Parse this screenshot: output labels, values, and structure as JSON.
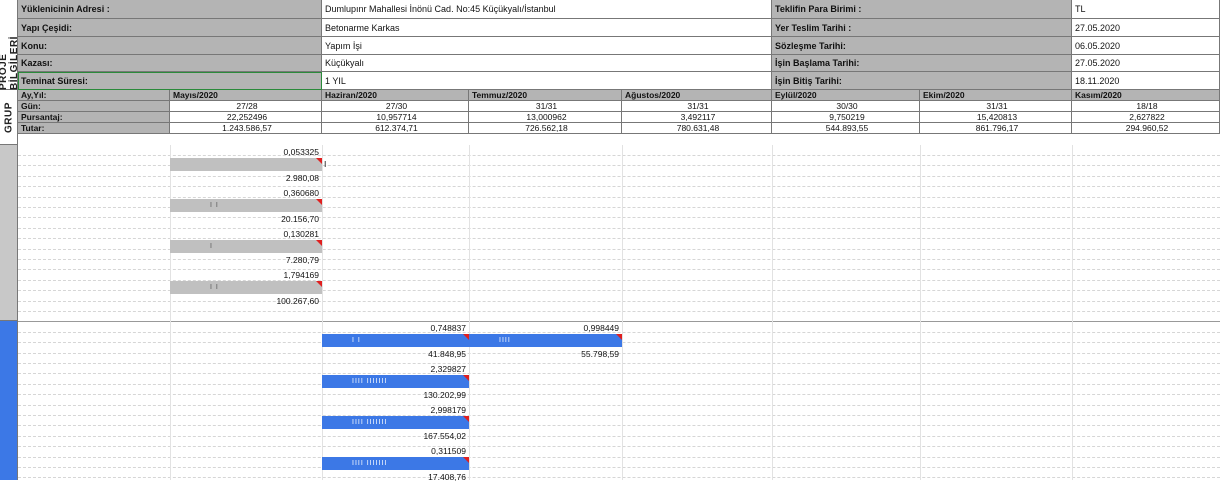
{
  "side_labels": {
    "project_info": "PROJE BİLGİLERİ",
    "group": "GRUP"
  },
  "info": {
    "rows": [
      {
        "label": "Yüklenicinin Adresi :",
        "value": "Dumlupınr Mahallesi İnönü Cad. No:45 Küçükyalı/İstanbul",
        "label2": "Teklifin Para Birimi :",
        "value2": "TL"
      },
      {
        "label": "Yapı Çeşidi:",
        "value": "Betonarme Karkas",
        "label2": "Yer Teslim Tarihi :",
        "value2": "27.05.2020"
      },
      {
        "label": "Konu:",
        "value": "Yapım İşi",
        "label2": "Sözleşme Tarihi:",
        "value2": "06.05.2020"
      },
      {
        "label": "Kazası:",
        "value": "Küçükyalı",
        "label2": "İşin Başlama Tarihi:",
        "value2": "27.05.2020"
      },
      {
        "label": "Teminat Süresi:",
        "value": "1 YIL",
        "label2": "İşin Bitiş Tarihi:",
        "value2": "18.11.2020"
      }
    ]
  },
  "schedule": {
    "row_labels": {
      "month": "Ay,Yıl:",
      "days": "Gün:",
      "percent": "Pursantaj:",
      "amount": "Tutar:"
    },
    "months": [
      {
        "name": "Mayıs/2020",
        "days": "27/28",
        "percent": "22,252496",
        "amount": "1.243.586,57"
      },
      {
        "name": "Haziran/2020",
        "days": "27/30",
        "percent": "10,957714",
        "amount": "612.374,71"
      },
      {
        "name": "Temmuz/2020",
        "days": "31/31",
        "percent": "13,000962",
        "amount": "726.562,18"
      },
      {
        "name": "Ağustos/2020",
        "days": "31/31",
        "percent": "3,492117",
        "amount": "780.631,48"
      },
      {
        "name": "Eylül/2020",
        "days": "30/30",
        "percent": "9,750219",
        "amount": "544.893,55"
      },
      {
        "name": "Ekim/2020",
        "days": "31/31",
        "percent": "15,420813",
        "amount": "861.796,17"
      },
      {
        "name": "Kasım/2020",
        "days": "18/18",
        "percent": "2,627822",
        "amount": "294.960,52"
      }
    ]
  },
  "tasks": [
    {
      "group": 1,
      "color": "#c0c0c0",
      "segments": [
        {
          "month": 0,
          "percent": "0,053325",
          "amount": "2.980,08",
          "ticks": "",
          "after_mark": "I"
        }
      ]
    },
    {
      "group": 1,
      "color": "#c0c0c0",
      "segments": [
        {
          "month": 0,
          "percent": "0,360680",
          "amount": "20.156,70",
          "ticks": "I I"
        }
      ]
    },
    {
      "group": 1,
      "color": "#c0c0c0",
      "segments": [
        {
          "month": 0,
          "percent": "0,130281",
          "amount": "7.280,79",
          "ticks": "I"
        }
      ]
    },
    {
      "group": 1,
      "color": "#c0c0c0",
      "segments": [
        {
          "month": 0,
          "percent": "1,794169",
          "amount": "100.267,60",
          "ticks": "I I"
        }
      ]
    },
    {
      "group": 2,
      "color": "#3c78e6",
      "segments": [
        {
          "month": 1,
          "percent": "0,748837",
          "amount": "41.848,95",
          "ticks": "I I"
        },
        {
          "month": 2,
          "percent": "0,998449",
          "amount": "55.798,59",
          "ticks": "IIII"
        }
      ]
    },
    {
      "group": 2,
      "color": "#3c78e6",
      "segments": [
        {
          "month": 1,
          "percent": "2,329827",
          "amount": "130.202,99",
          "ticks": "IIII         IIIIIII"
        }
      ]
    },
    {
      "group": 2,
      "color": "#3c78e6",
      "segments": [
        {
          "month": 1,
          "percent": "2,998179",
          "amount": "167.554,02",
          "ticks": "IIII         IIIIIII"
        }
      ]
    },
    {
      "group": 2,
      "color": "#3c78e6",
      "segments": [
        {
          "month": 1,
          "percent": "0,311509",
          "amount": "17.408,76",
          "ticks": "IIII         IIIIIII"
        }
      ]
    }
  ]
}
